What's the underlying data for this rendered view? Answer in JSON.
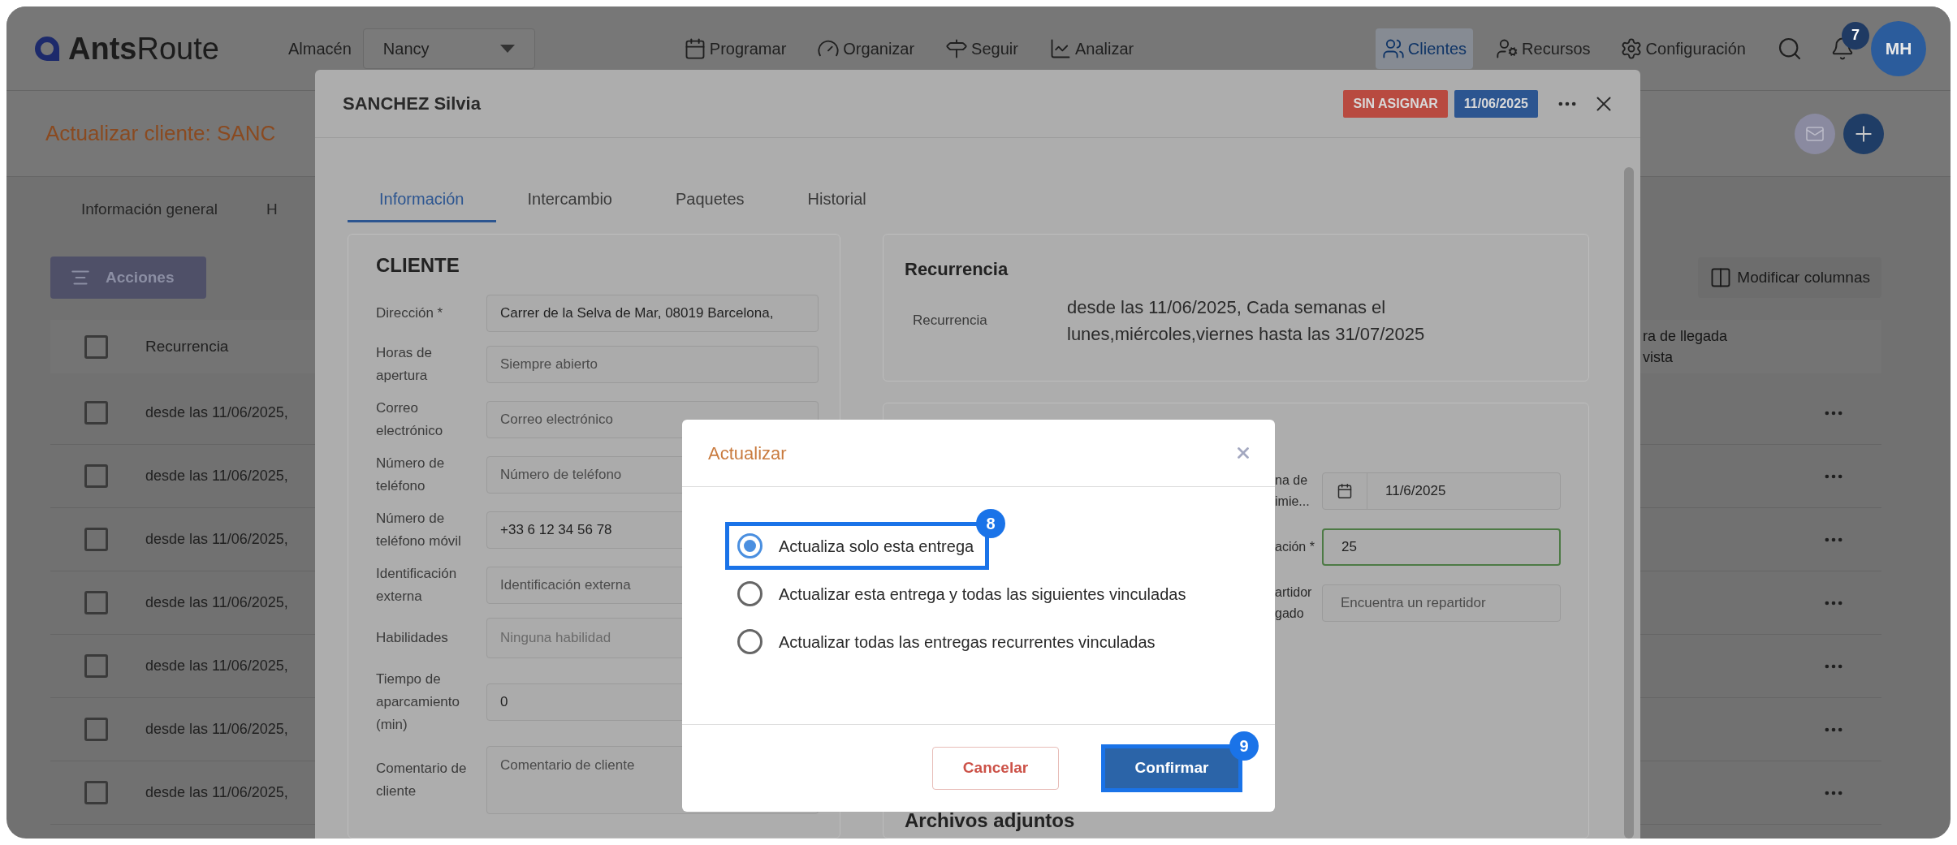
{
  "header": {
    "logo": "**Ants**Route",
    "warehouse_label": "Almacén",
    "warehouse_value": "Nancy",
    "nav": [
      {
        "label": "Programar",
        "selected": false
      },
      {
        "label": "Organizar",
        "selected": false
      },
      {
        "label": "Seguir",
        "selected": false
      },
      {
        "label": "Analizar",
        "selected": false
      }
    ],
    "nav_right": [
      {
        "label": "Clientes",
        "selected": true
      },
      {
        "label": "Recursos",
        "selected": false
      },
      {
        "label": "Configuración",
        "selected": false
      }
    ],
    "notification_count": "7",
    "avatar": "MH"
  },
  "page": {
    "title": "Actualizar cliente: SANC",
    "tabs": [
      {
        "label": "Información general"
      },
      {
        "label": "H"
      }
    ],
    "actions_button": "Acciones",
    "columns_button": "Modificar columnas",
    "table": {
      "header_checked": false,
      "column_1": "Recurrencia",
      "column_2": [
        "ra de llegada",
        "vista"
      ],
      "rows": [
        {
          "checked": false,
          "recurrence": "desde las 11/06/2025,"
        },
        {
          "checked": false,
          "recurrence": "desde las 11/06/2025,"
        },
        {
          "checked": false,
          "recurrence": "desde las 11/06/2025,"
        },
        {
          "checked": false,
          "recurrence": "desde las 11/06/2025,"
        },
        {
          "checked": false,
          "recurrence": "desde las 11/06/2025,"
        },
        {
          "checked": false,
          "recurrence": "desde las 11/06/2025,"
        },
        {
          "checked": false,
          "recurrence": "desde las 11/06/2025,"
        }
      ]
    }
  },
  "drawer": {
    "title": "SANCHEZ Silvia",
    "badges": [
      {
        "label": "SIN ASIGNAR",
        "color": "#b84a40"
      },
      {
        "label": "11/06/2025",
        "color": "#2c5590"
      }
    ],
    "tabs": [
      {
        "label": "Información",
        "selected": true
      },
      {
        "label": "Intercambio",
        "selected": false
      },
      {
        "label": "Paquetes",
        "selected": false
      },
      {
        "label": "Historial",
        "selected": false
      }
    ],
    "client_card": {
      "title": "CLIENTE",
      "fields": [
        {
          "kind": "input",
          "label": "Dirección *",
          "value": "Carrer de la Selva de Mar, 08019 Barcelona,"
        },
        {
          "kind": "input",
          "label": "Horas de apertura",
          "placeholder": "Siempre abierto"
        },
        {
          "kind": "input",
          "label": "Correo electrónico",
          "placeholder": "Correo electrónico"
        },
        {
          "kind": "input",
          "label": "Número de teléfono",
          "placeholder": "Número de teléfono"
        },
        {
          "kind": "input",
          "label": "Número de teléfono móvil",
          "value": "+33 6 12 34 56 78"
        },
        {
          "kind": "input",
          "label": "Identificación externa",
          "placeholder": "Identificación externa"
        },
        {
          "kind": "select",
          "label": "Habilidades",
          "placeholder": "Ninguna habilidad"
        },
        {
          "kind": "input",
          "label": "Tiempo de aparcamiento (min)",
          "value": "0"
        },
        {
          "kind": "textarea",
          "label": "Comentario de cliente",
          "placeholder": "Comentario de cliente"
        }
      ]
    },
    "recurrence_card": {
      "title": "Recurrencia",
      "label": "Recurrencia",
      "value": "desde las 11/06/2025, Cada semanas el lunes,miércoles,viernes hasta las 31/07/2025"
    },
    "delivery_card": {
      "fields": [
        {
          "kind": "date",
          "label_lines": [
            "na de",
            "imie..."
          ],
          "value": "11/6/2025",
          "valid": false
        },
        {
          "kind": "input",
          "label_lines": [
            "ación *"
          ],
          "value": "25",
          "valid": true
        },
        {
          "kind": "input",
          "label_lines": [
            "artidor",
            "gado"
          ],
          "placeholder": "Encuentra un repartidor",
          "valid": false
        }
      ],
      "attachments_title": "Archivos adjuntos"
    }
  },
  "dialog": {
    "title": "Actualizar",
    "options": [
      {
        "label": "Actualiza solo esta entrega",
        "selected": true,
        "step": "8"
      },
      {
        "label": "Actualizar esta entrega y todas las siguientes vinculadas",
        "selected": false
      },
      {
        "label": "Actualizar todas las entregas recurrentes vinculadas",
        "selected": false
      }
    ],
    "cancel": "Cancelar",
    "confirm": {
      "label": "Confirmar",
      "step": "9"
    }
  }
}
